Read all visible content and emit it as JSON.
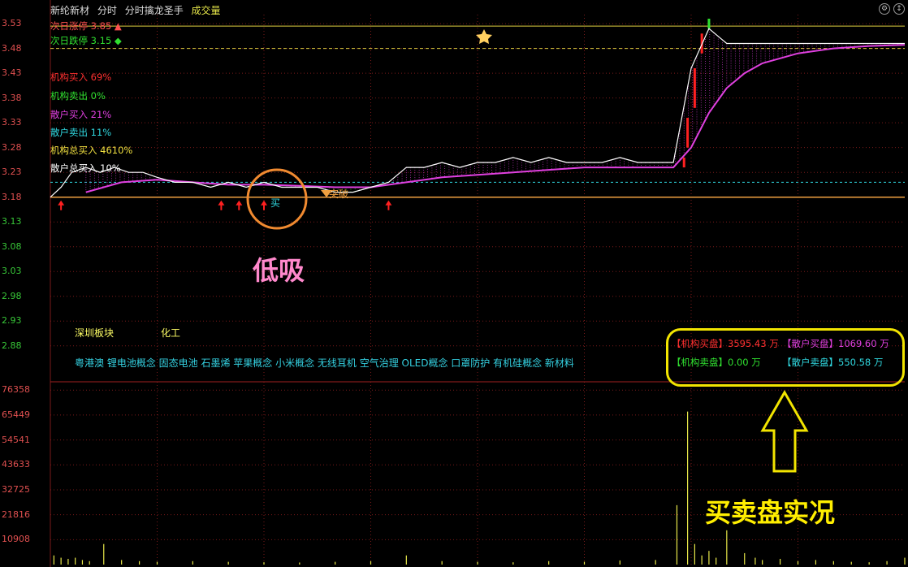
{
  "header": {
    "stock_name": "新纶新材",
    "view": "分时",
    "indicator_name": "分时擒龙圣手",
    "volume_label": "成交量"
  },
  "indicators": {
    "next_limit_up": "次日涨停 3.85 ▲",
    "next_limit_down": "次日跌停 3.15 ◆",
    "inst_buy": "机构买入 69%",
    "inst_sell": "机构卖出 0%",
    "retail_buy": "散户买入 21%",
    "retail_sell": "散户卖出 11%",
    "inst_total_buy": "机构总买入 4610%",
    "retail_total_buy": "散户总买入 10%"
  },
  "annotations": {
    "buy_marker": "买",
    "breakout": "突破",
    "low_absorb": "低吸",
    "buy_sell_actual": "买卖盘实况"
  },
  "sector": {
    "label": "深圳板块",
    "value": "化工"
  },
  "concepts": "粤港澳 锂电池概念 固态电池 石墨烯 苹果概念 小米概念 无线耳机 空气治理 OLED概念 口罩防护 有机硅概念 新材料",
  "buy_sell": {
    "inst_buy": "【机构买盘】3595.43 万",
    "retail_buy": "【散户买盘】1069.60 万",
    "inst_sell": "【机构卖盘】0.00 万",
    "retail_sell": "【散户卖盘】550.58 万"
  },
  "colors": {
    "background": "#000000",
    "price_line": "#ffffff",
    "avg_line": "#e040e0",
    "grid": "#7a1a1a",
    "limit_up": "#ff4040",
    "limit_down": "#30e030",
    "volume": "#e8e84a",
    "annotation_pink": "#ff88cc",
    "annotation_yellow": "#ffee00",
    "circle": "#f08a30"
  },
  "chart_data": [
    {
      "type": "line",
      "y_ticks": [
        3.53,
        3.48,
        3.43,
        3.38,
        3.33,
        3.28,
        3.23,
        3.18,
        3.13,
        3.08,
        3.03,
        2.98,
        2.93,
        2.88
      ],
      "ylim": [
        2.86,
        3.54
      ],
      "reference_lines": [
        3.48,
        3.18
      ],
      "series": [
        {
          "key": "price",
          "x": [
            0,
            3,
            6,
            10,
            14,
            18,
            22,
            26,
            30,
            35,
            40,
            45,
            50,
            55,
            60,
            65,
            70,
            75,
            80,
            85,
            90,
            95,
            100,
            105,
            110,
            115,
            120,
            125,
            130,
            135,
            140,
            145,
            150,
            155,
            160,
            165,
            170,
            175,
            180,
            185,
            190,
            195,
            200,
            205,
            210,
            215,
            220,
            225,
            230,
            235,
            240
          ],
          "values": [
            3.18,
            3.2,
            3.23,
            3.24,
            3.23,
            3.24,
            3.23,
            3.23,
            3.22,
            3.21,
            3.21,
            3.2,
            3.21,
            3.2,
            3.21,
            3.2,
            3.2,
            3.2,
            3.19,
            3.19,
            3.2,
            3.21,
            3.24,
            3.24,
            3.25,
            3.24,
            3.25,
            3.25,
            3.26,
            3.25,
            3.26,
            3.25,
            3.25,
            3.25,
            3.26,
            3.25,
            3.25,
            3.25,
            3.44,
            3.52,
            3.49,
            3.49,
            3.49,
            3.49,
            3.49,
            3.49,
            3.49,
            3.49,
            3.49,
            3.49,
            3.49
          ]
        },
        {
          "key": "avg",
          "x": [
            10,
            20,
            30,
            40,
            50,
            60,
            70,
            80,
            90,
            100,
            110,
            120,
            130,
            140,
            150,
            160,
            170,
            175,
            180,
            185,
            190,
            195,
            200,
            210,
            220,
            230,
            240
          ],
          "values": [
            3.19,
            3.21,
            3.215,
            3.21,
            3.205,
            3.205,
            3.203,
            3.2,
            3.2,
            3.21,
            3.22,
            3.225,
            3.23,
            3.235,
            3.24,
            3.24,
            3.24,
            3.24,
            3.28,
            3.35,
            3.4,
            3.43,
            3.45,
            3.47,
            3.48,
            3.485,
            3.487
          ]
        }
      ],
      "buy_arrows_x": [
        3,
        48,
        53,
        60,
        95
      ]
    },
    {
      "type": "bar",
      "y_ticks": [
        76358,
        65449,
        54541,
        43633,
        32725,
        21816,
        10908
      ],
      "ylim": [
        0,
        80000
      ],
      "x": [
        1,
        3,
        5,
        7,
        9,
        11,
        15,
        20,
        25,
        30,
        40,
        50,
        60,
        70,
        80,
        90,
        100,
        110,
        120,
        130,
        140,
        150,
        160,
        170,
        176,
        179,
        181,
        183,
        185,
        187,
        190,
        195,
        198,
        200,
        205,
        210,
        215,
        220,
        225,
        230,
        235,
        240
      ],
      "values": [
        4000,
        3000,
        2500,
        3000,
        2000,
        1500,
        9000,
        2000,
        1500,
        1200,
        1500,
        1200,
        1000,
        900,
        1200,
        1500,
        4000,
        1500,
        1200,
        1000,
        1500,
        1200,
        1800,
        2000,
        26000,
        67000,
        9000,
        4000,
        6000,
        3000,
        15000,
        5000,
        3000,
        2000,
        2500,
        1500,
        2000,
        1500,
        1200,
        1000,
        1500,
        3000
      ]
    }
  ]
}
